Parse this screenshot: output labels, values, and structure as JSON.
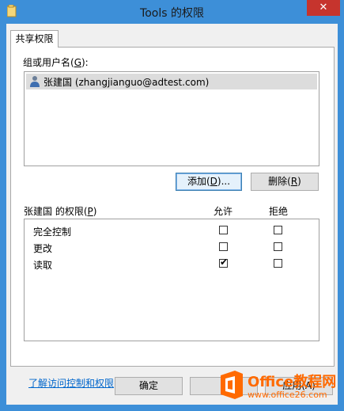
{
  "window": {
    "title": "Tools 的权限",
    "close_glyph": "✕",
    "icon": "folder-icon"
  },
  "tabs": [
    {
      "label": "共享权限"
    }
  ],
  "users_section": {
    "label_prefix": "组或用户名(",
    "label_key": "G",
    "label_suffix": "):",
    "users": [
      {
        "name": "张建国 (zhangjianguo@adtest.com)",
        "icon": "user-icon",
        "selected": true
      }
    ]
  },
  "buttons": {
    "add": {
      "prefix": "添加(",
      "key": "D",
      "suffix": ")..."
    },
    "remove": {
      "prefix": "删除(",
      "key": "R",
      "suffix": ")"
    }
  },
  "permissions": {
    "label_prefix": "张建国 的权限(",
    "label_key": "P",
    "label_suffix": ")",
    "allow_header": "允许",
    "deny_header": "拒绝",
    "rows": [
      {
        "name": "完全控制",
        "allow": false,
        "deny": false
      },
      {
        "name": "更改",
        "allow": false,
        "deny": false
      },
      {
        "name": "读取",
        "allow": true,
        "deny": false
      }
    ]
  },
  "help_link": "了解访问控制和权限",
  "footer": {
    "ok_label": "确定",
    "cancel_label": "",
    "apply_label": "应用(A)"
  },
  "watermark": {
    "text": "Office教程网",
    "url": "www.office26.com"
  },
  "colors": {
    "title_bar": "#3d8fd8",
    "close_button": "#c6342d",
    "link": "#0066cc",
    "watermark": "#ff6a00"
  }
}
